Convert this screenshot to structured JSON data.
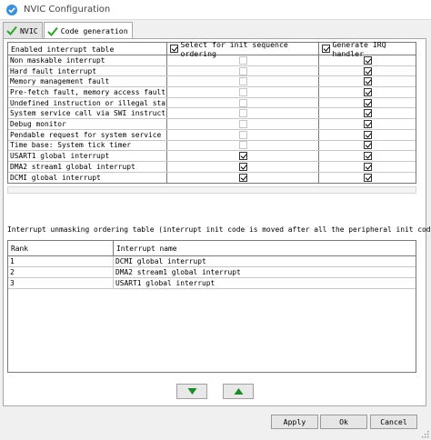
{
  "window": {
    "title": "NVIC Configuration"
  },
  "tabs": [
    {
      "label": "NVIC",
      "active": false
    },
    {
      "label": "Code generation",
      "active": true
    }
  ],
  "enabled_table": {
    "headers": {
      "name": "Enabled interrupt table",
      "init_sequence": "Select for init sequence ordering",
      "irq_handler": "Generate IRQ handler"
    },
    "header_checks": {
      "init_sequence": true,
      "irq_handler": true
    },
    "rows": [
      {
        "name": "Non maskable interrupt",
        "init": false,
        "init_enabled": false,
        "irq": true
      },
      {
        "name": "Hard fault interrupt",
        "init": false,
        "init_enabled": false,
        "irq": true
      },
      {
        "name": "Memory management fault",
        "init": false,
        "init_enabled": false,
        "irq": true
      },
      {
        "name": "Pre-fetch fault, memory access fault",
        "init": false,
        "init_enabled": false,
        "irq": true
      },
      {
        "name": "Undefined instruction or illegal state",
        "init": false,
        "init_enabled": false,
        "irq": true
      },
      {
        "name": "System service call via SWI instruction",
        "init": false,
        "init_enabled": false,
        "irq": true
      },
      {
        "name": "Debug monitor",
        "init": false,
        "init_enabled": false,
        "irq": true
      },
      {
        "name": "Pendable request for system service",
        "init": false,
        "init_enabled": false,
        "irq": true
      },
      {
        "name": "Time base: System tick timer",
        "init": false,
        "init_enabled": false,
        "irq": true
      },
      {
        "name": "USART1 global interrupt",
        "init": true,
        "init_enabled": true,
        "irq": true
      },
      {
        "name": "DMA2 stream1 global interrupt",
        "init": true,
        "init_enabled": true,
        "irq": true
      },
      {
        "name": "DCMI global interrupt",
        "init": true,
        "init_enabled": true,
        "irq": true
      }
    ]
  },
  "ordering": {
    "label": "Interrupt unmasking ordering table (interrupt init code is moved after all the peripheral init code)",
    "headers": {
      "rank": "Rank",
      "name": "Interrupt name"
    },
    "rows": [
      {
        "rank": "1",
        "name": "DCMI global interrupt"
      },
      {
        "rank": "2",
        "name": "DMA2 stream1 global interrupt"
      },
      {
        "rank": "3",
        "name": "USART1 global interrupt"
      }
    ]
  },
  "buttons": {
    "down_icon": "arrow-down-icon",
    "up_icon": "arrow-up-icon",
    "apply": "Apply",
    "ok": "Ok",
    "cancel": "Cancel"
  },
  "colors": {
    "arrow_green": "#1a8a2a",
    "tab_check_green": "#2aa52a",
    "app_icon_blue": "#3b8fd6"
  }
}
